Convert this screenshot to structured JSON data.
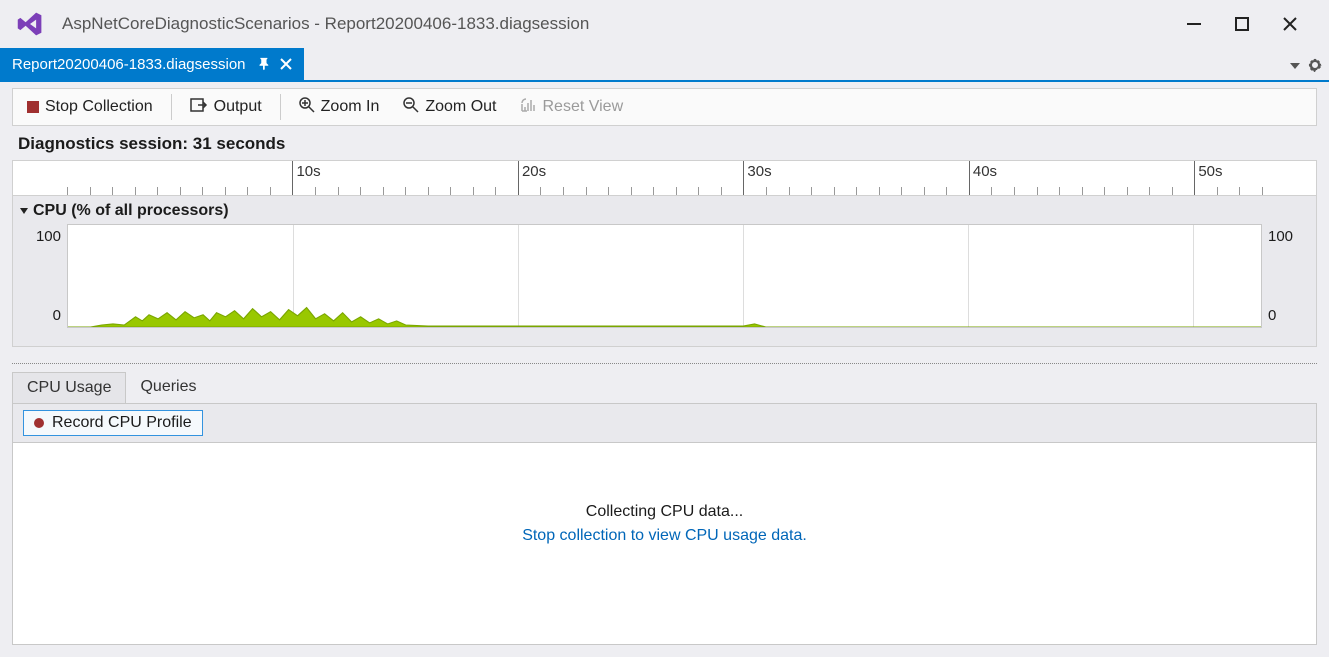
{
  "titlebar": {
    "app_title": "AspNetCoreDiagnosticScenarios - Report20200406-1833.diagsession"
  },
  "doctab": {
    "label": "Report20200406-1833.diagsession"
  },
  "toolbar": {
    "stop": "Stop Collection",
    "output": "Output",
    "zoom_in": "Zoom In",
    "zoom_out": "Zoom Out",
    "reset_view": "Reset View"
  },
  "session": {
    "label": "Diagnostics session: 31 seconds"
  },
  "ruler": {
    "ticks": [
      "10s",
      "20s",
      "30s",
      "40s",
      "50s"
    ],
    "span_seconds": 53
  },
  "chart": {
    "title": "CPU (% of all processors)",
    "ymax_left": "100",
    "ymin_left": "0",
    "ymax_right": "100",
    "ymin_right": "0"
  },
  "chart_data": {
    "type": "area",
    "title": "CPU (% of all processors)",
    "xlabel": "seconds",
    "ylabel": "CPU %",
    "ylim": [
      0,
      100
    ],
    "xlim": [
      0,
      53
    ],
    "series": [
      {
        "name": "CPU %",
        "x": [
          0,
          1,
          1.5,
          2,
          2.5,
          3,
          3.3,
          3.6,
          4,
          4.4,
          4.8,
          5.2,
          5.6,
          6,
          6.3,
          6.6,
          7,
          7.4,
          7.8,
          8.2,
          8.6,
          9,
          9.4,
          9.8,
          10.2,
          10.6,
          11,
          11.4,
          11.8,
          12.2,
          12.6,
          13,
          13.4,
          13.8,
          14.2,
          14.6,
          15,
          16,
          20,
          25,
          30,
          30.5,
          31,
          53
        ],
        "values": [
          0,
          0,
          2,
          3,
          2,
          10,
          6,
          12,
          8,
          14,
          7,
          15,
          9,
          12,
          6,
          14,
          10,
          16,
          8,
          18,
          10,
          15,
          7,
          17,
          11,
          19,
          8,
          13,
          6,
          14,
          5,
          10,
          4,
          8,
          3,
          6,
          2,
          1,
          1,
          1,
          1,
          3,
          0,
          0
        ]
      }
    ]
  },
  "subtabs": {
    "active": "CPU Usage",
    "other": "Queries"
  },
  "recordbar": {
    "button": "Record CPU Profile"
  },
  "msg": {
    "line1": "Collecting CPU data...",
    "line2": "Stop collection to view CPU usage data."
  },
  "colors": {
    "accent": "#007acc",
    "cpu_fill": "#99c800"
  }
}
